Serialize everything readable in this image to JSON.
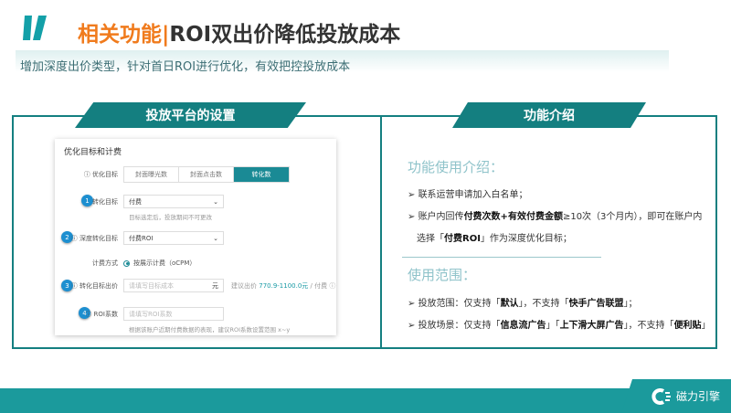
{
  "header": {
    "title_prefix": "相关功能",
    "title_sep": "|",
    "title_main": "ROI双出价降低投放成本",
    "subtitle": "增加深度出价类型，针对首日ROI进行优化，有效把控投放成本"
  },
  "left": {
    "tab": "投放平台的设置",
    "panel": {
      "heading": "优化目标和计费",
      "opt_label": "优化目标",
      "opt_options": [
        "封面曝光数",
        "封面点击数",
        "转化数"
      ],
      "conv_label": "转化目标",
      "conv_value": "付费",
      "conv_hint": "目标选定后，投放期间不可更改",
      "deep_label": "深度转化目标",
      "deep_value": "付费ROI",
      "bill_label": "计费方式",
      "bill_value": "按展示计费（oCPM）",
      "bid_label": "转化目标出价",
      "bid_placeholder": "请填写目标成本",
      "bid_unit": "元",
      "bid_suggest_prefix": "建议出价",
      "bid_suggest_range": "770.9-1100.0元",
      "bid_suggest_suffix": "/ 付费",
      "roi_label": "ROI系数",
      "roi_placeholder": "请填写ROI系数",
      "roi_hint": "根据该账户近期付费数据的表现，建议ROI系数设置范围 x~y",
      "steps": [
        "1",
        "2",
        "3",
        "4"
      ]
    }
  },
  "right": {
    "tab": "功能介绍",
    "sec1": "功能使用介绍：",
    "item1": "联系运营申请加入白名单；",
    "item2_a": "账户内回传",
    "item2_b": "付费次数+有效付费金额",
    "item2_c": "≥10次（3个月内），即可在账户内",
    "item2_d": "选择「",
    "item2_e": "付费ROI",
    "item2_f": "」作为深度优化目标；",
    "sec2": "使用范围：",
    "item3_a": "投放范围：仅支持「",
    "item3_b": "默认",
    "item3_c": "」，不支持「",
    "item3_d": "快手广告联盟",
    "item3_e": "」；",
    "item4_a": "投放场景：仅支持「",
    "item4_b": "信息流广告",
    "item4_c": "」「",
    "item4_d": "上下滑大屏广告",
    "item4_e": "」，不支持「",
    "item4_f": "便利贴",
    "item4_g": "」"
  },
  "footer": {
    "brand": "磁力引擎"
  },
  "colors": {
    "accent": "#147f80",
    "orange": "#f07b1d"
  }
}
